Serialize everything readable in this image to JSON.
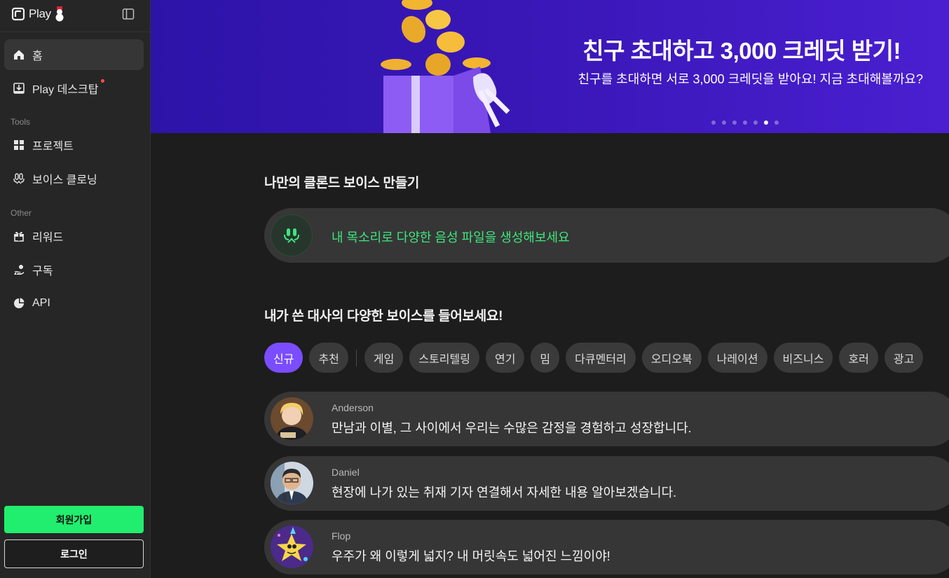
{
  "app": {
    "logo_text": "Play"
  },
  "sidebar": {
    "nav": [
      {
        "label": "홈",
        "icon": "home-icon"
      },
      {
        "label": "Play 데스크탑",
        "icon": "download-icon"
      }
    ],
    "tools_label": "Tools",
    "tools": [
      {
        "label": "프로젝트",
        "icon": "grid-icon"
      },
      {
        "label": "보이스 클로닝",
        "icon": "voice-clone-icon"
      }
    ],
    "other_label": "Other",
    "other": [
      {
        "label": "리워드",
        "icon": "gift-icon"
      },
      {
        "label": "구독",
        "icon": "hand-coin-icon"
      },
      {
        "label": "API",
        "icon": "pie-chart-icon"
      }
    ],
    "signup_label": "회원가입",
    "login_label": "로그인"
  },
  "banner": {
    "title": "친구 초대하고 3,000 크레딧 받기!",
    "subtitle": "친구를 초대하면 서로 3,000 크레딧을 받아요! 지금 초대해볼까요?",
    "slide_count": 7,
    "active_slide": 6
  },
  "clone": {
    "heading": "나만의 클론드 보이스 만들기",
    "cta": "내 목소리로 다양한 음성 파일을 생성해보세요"
  },
  "voices": {
    "heading": "내가 쓴 대사의 다양한 보이스를 들어보세요!",
    "chips": [
      "신규",
      "추천",
      "게임",
      "스토리텔링",
      "연기",
      "밈",
      "다큐멘터리",
      "오디오북",
      "나레이션",
      "비즈니스",
      "호러",
      "광고"
    ],
    "active_chip": 0,
    "items": [
      {
        "name": "Anderson",
        "line": "만남과 이별, 그 사이에서 우리는 수많은 감정을 경험하고 성장합니다."
      },
      {
        "name": "Daniel",
        "line": "현장에 나가 있는 취재 기자 연결해서 자세한 내용 알아보겠습니다."
      },
      {
        "name": "Flop",
        "line": "우주가 왜 이렇게 넓지? 내 머릿속도 넓어진 느낌이야!"
      }
    ]
  },
  "colors": {
    "accent_green": "#21ee6e",
    "accent_purple": "#7a4dff",
    "banner_bg": "#3a17b8"
  }
}
